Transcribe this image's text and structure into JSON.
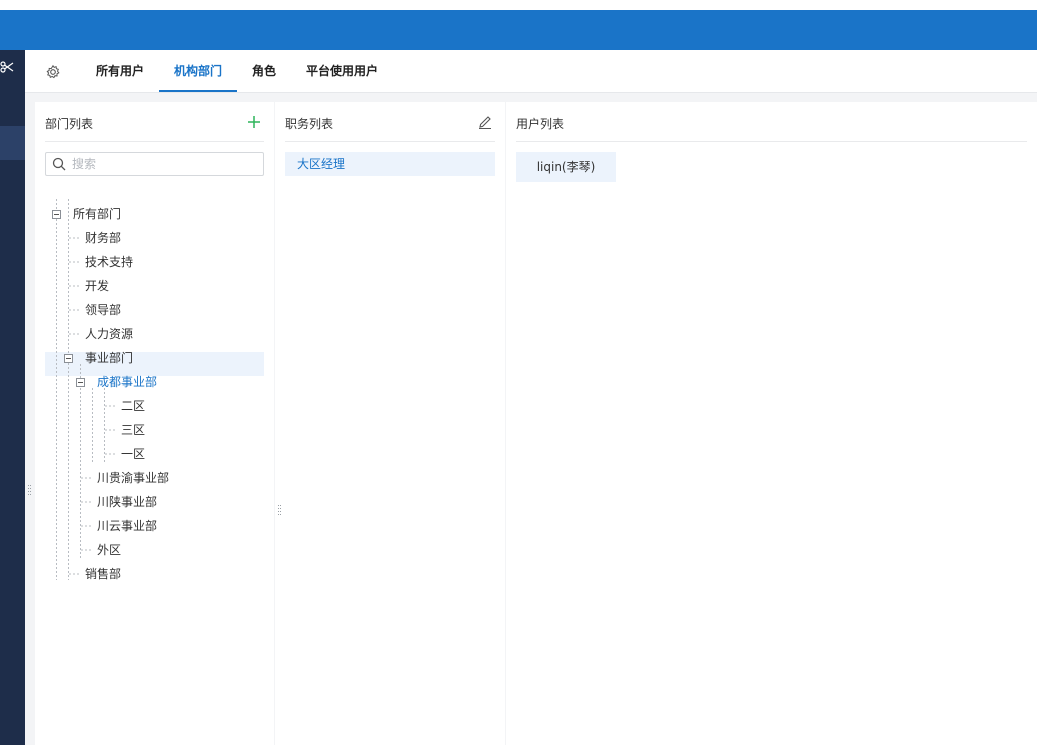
{
  "tabs": [
    {
      "label": "所有用户"
    },
    {
      "label": "机构部门",
      "active": true
    },
    {
      "label": "角色"
    },
    {
      "label": "平台使用用户"
    }
  ],
  "icons": {
    "settings": "gear-icon",
    "add": "plus-icon",
    "edit": "pencil-icon",
    "search": "search-icon",
    "collapse": "minus-square-icon",
    "nav": "scissors-icon"
  },
  "colors": {
    "topbar": "#1a74c8",
    "nav": "#1e2d4a",
    "accent": "#1a74c8",
    "selection": "#ecf3fc",
    "add_icon": "#2db45a"
  },
  "departments": {
    "title": "部门列表",
    "search": {
      "placeholder": "搜索",
      "value": ""
    },
    "tree": {
      "root": "所有部门",
      "items": [
        "财务部",
        "技术支持",
        "开发",
        "领导部",
        "人力资源"
      ],
      "business": {
        "label": "事业部门",
        "chengdu": {
          "label": "成都事业部",
          "selected": true,
          "children": [
            "二区",
            "三区",
            "一区"
          ]
        },
        "others": [
          "川贵渝事业部",
          "川陕事业部",
          "川云事业部",
          "外区"
        ]
      },
      "last": "销售部"
    }
  },
  "positions": {
    "title": "职务列表",
    "items": [
      "大区经理"
    ]
  },
  "users": {
    "title": "用户列表",
    "items": [
      "liqin(李琴)"
    ]
  }
}
